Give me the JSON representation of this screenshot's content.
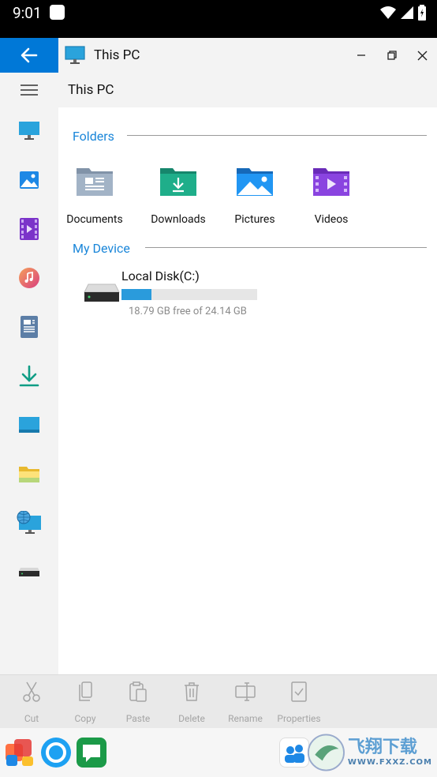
{
  "status": {
    "time": "9:01"
  },
  "window": {
    "title": "This PC"
  },
  "address": {
    "crumb": "This PC"
  },
  "sections": {
    "folders": "Folders",
    "device": "My Device"
  },
  "folders": [
    {
      "label": "Documents",
      "icon": "documents-folder-icon"
    },
    {
      "label": "Downloads",
      "icon": "downloads-folder-icon"
    },
    {
      "label": "Pictures",
      "icon": "pictures-folder-icon"
    },
    {
      "label": "Videos",
      "icon": "videos-folder-icon"
    }
  ],
  "disk": {
    "name": "Local Disk(C:)",
    "free_text": "18.79 GB free of 24.14 GB",
    "used_fraction": 0.22
  },
  "toolbar": {
    "cut": "Cut",
    "copy": "Copy",
    "paste": "Paste",
    "delete": "Delete",
    "rename": "Rename",
    "properties": "Properties"
  },
  "sidebar_icons": [
    "this-pc-icon",
    "pictures-icon",
    "videos-icon",
    "music-icon",
    "documents-icon",
    "downloads-icon",
    "desktop-icon",
    "folder-icon",
    "network-icon",
    "drive-icon"
  ],
  "colors": {
    "accent": "#0078d7",
    "section": "#1a86d9",
    "disk_fill": "#2a9bdc"
  },
  "watermark": "飞翔下载 WWW.FXXZ.COM"
}
